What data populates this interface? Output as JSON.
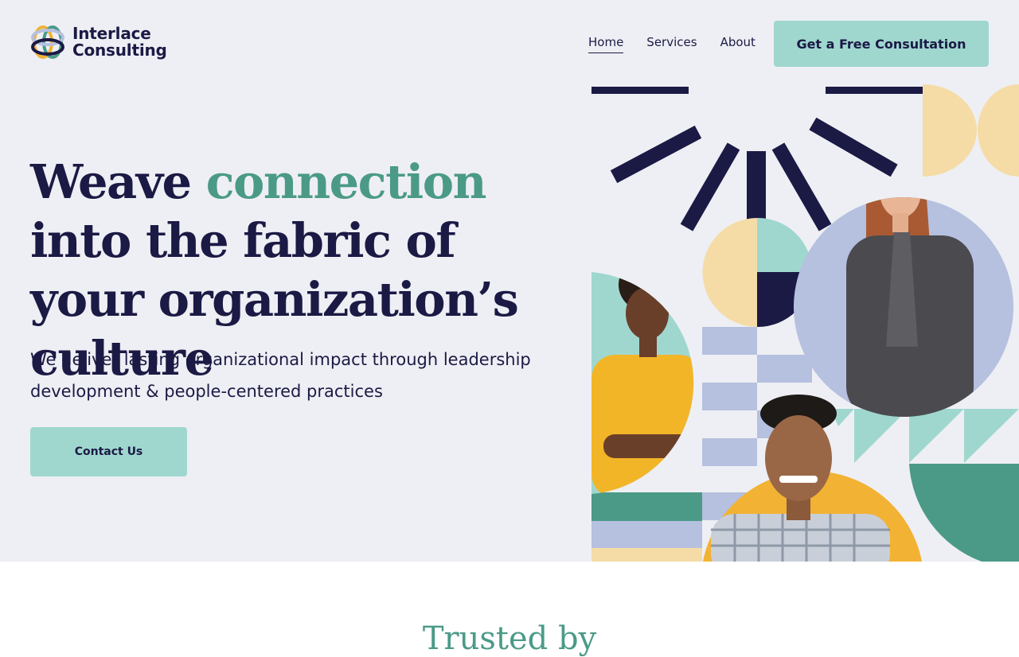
{
  "brand": {
    "name_line1": "Interlace",
    "name_line2": "Consulting",
    "icon": "interlaced-rings-logo"
  },
  "nav": {
    "items": [
      {
        "label": "Home",
        "active": true
      },
      {
        "label": "Services",
        "active": false
      },
      {
        "label": "About",
        "active": false
      }
    ]
  },
  "header": {
    "cta_label": "Get a Free Consultation"
  },
  "hero": {
    "headline_part1": "Weave ",
    "headline_accent": "connection",
    "headline_part2": " into the fabric of your organization’s culture",
    "subheadline": "We deliver lasting organizational impact through leadership development & people-centered practices",
    "cta_label": "Contact Us",
    "illustration_people": [
      "smiling-woman-yellow-top",
      "smiling-woman-dark-blazer",
      "smiling-man-plaid-shirt"
    ]
  },
  "trusted": {
    "heading": "Trusted by"
  },
  "colors": {
    "navy": "#1b1a45",
    "accent_green": "#4b9a88",
    "mint": "#9fd7cf",
    "hero_bg": "#eeeff4",
    "yellow": "#f2b233",
    "cream": "#f5dca6",
    "lavender": "#b6c0df"
  }
}
